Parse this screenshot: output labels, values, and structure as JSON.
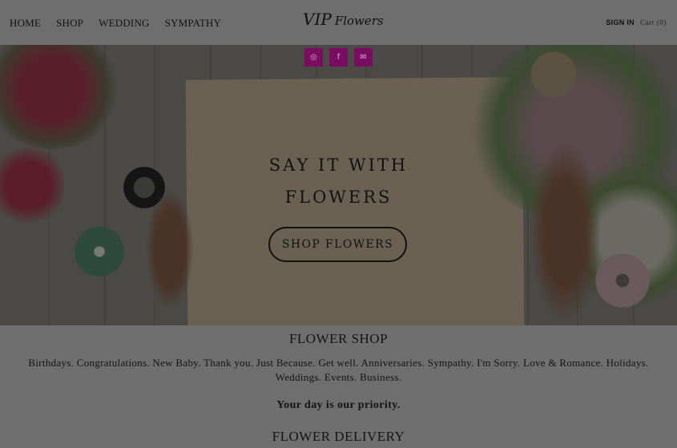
{
  "header": {
    "nav": [
      "HOME",
      "SHOP",
      "WEDDING",
      "SYMPATHY"
    ],
    "logo": "VIP",
    "logo_sub": "Flowers",
    "sign_in": "SIGN IN",
    "cart": "Cart (0)"
  },
  "social": [
    "instagram-icon",
    "facebook-icon",
    "mail-icon"
  ],
  "hero": {
    "line1": "SAY IT WITH",
    "line2": "FLOWERS",
    "cta": "SHOP FLOWERS"
  },
  "shop": {
    "title": "FLOWER SHOP",
    "tags": "Birthdays. Congratulations. New Baby. Thank you. Just Because. Get well. Anniversaries. Sympathy. I'm Sorry. Love & Romance. Holidays. Weddings. Events. Business.",
    "priority": "Your day is our priority."
  },
  "delivery": {
    "title": "FLOWER DELIVERY"
  },
  "colors": {
    "overlay": "#6e6e6e",
    "social_bg": "#7a0d62",
    "text": "#121212"
  }
}
